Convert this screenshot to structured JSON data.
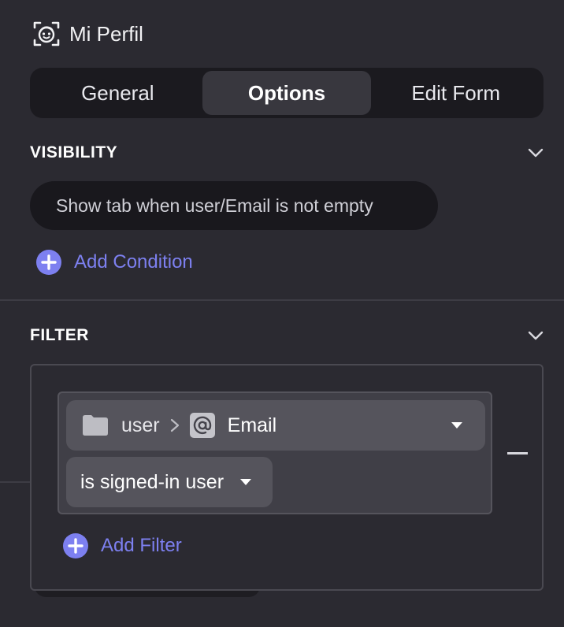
{
  "header": {
    "title": "Mi Perfil",
    "icon": "face-scan-icon"
  },
  "tabs": [
    {
      "label": "General",
      "active": false
    },
    {
      "label": "Options",
      "active": true
    },
    {
      "label": "Edit Form",
      "active": false
    }
  ],
  "visibility": {
    "title": "VISIBILITY",
    "condition": "Show tab when user/Email is not empty",
    "add_label": "Add Condition"
  },
  "filter": {
    "title": "FILTER",
    "field": {
      "parent": "user",
      "name": "Email",
      "icon": "at-sign-icon"
    },
    "operator": "is signed-in user",
    "add_label": "Add Filter"
  },
  "colors": {
    "background": "#2b2a31",
    "accent": "#7d80f0",
    "tab_bar": "#1b1a1f",
    "active_tab": "#38373e",
    "select": "#55545c"
  }
}
